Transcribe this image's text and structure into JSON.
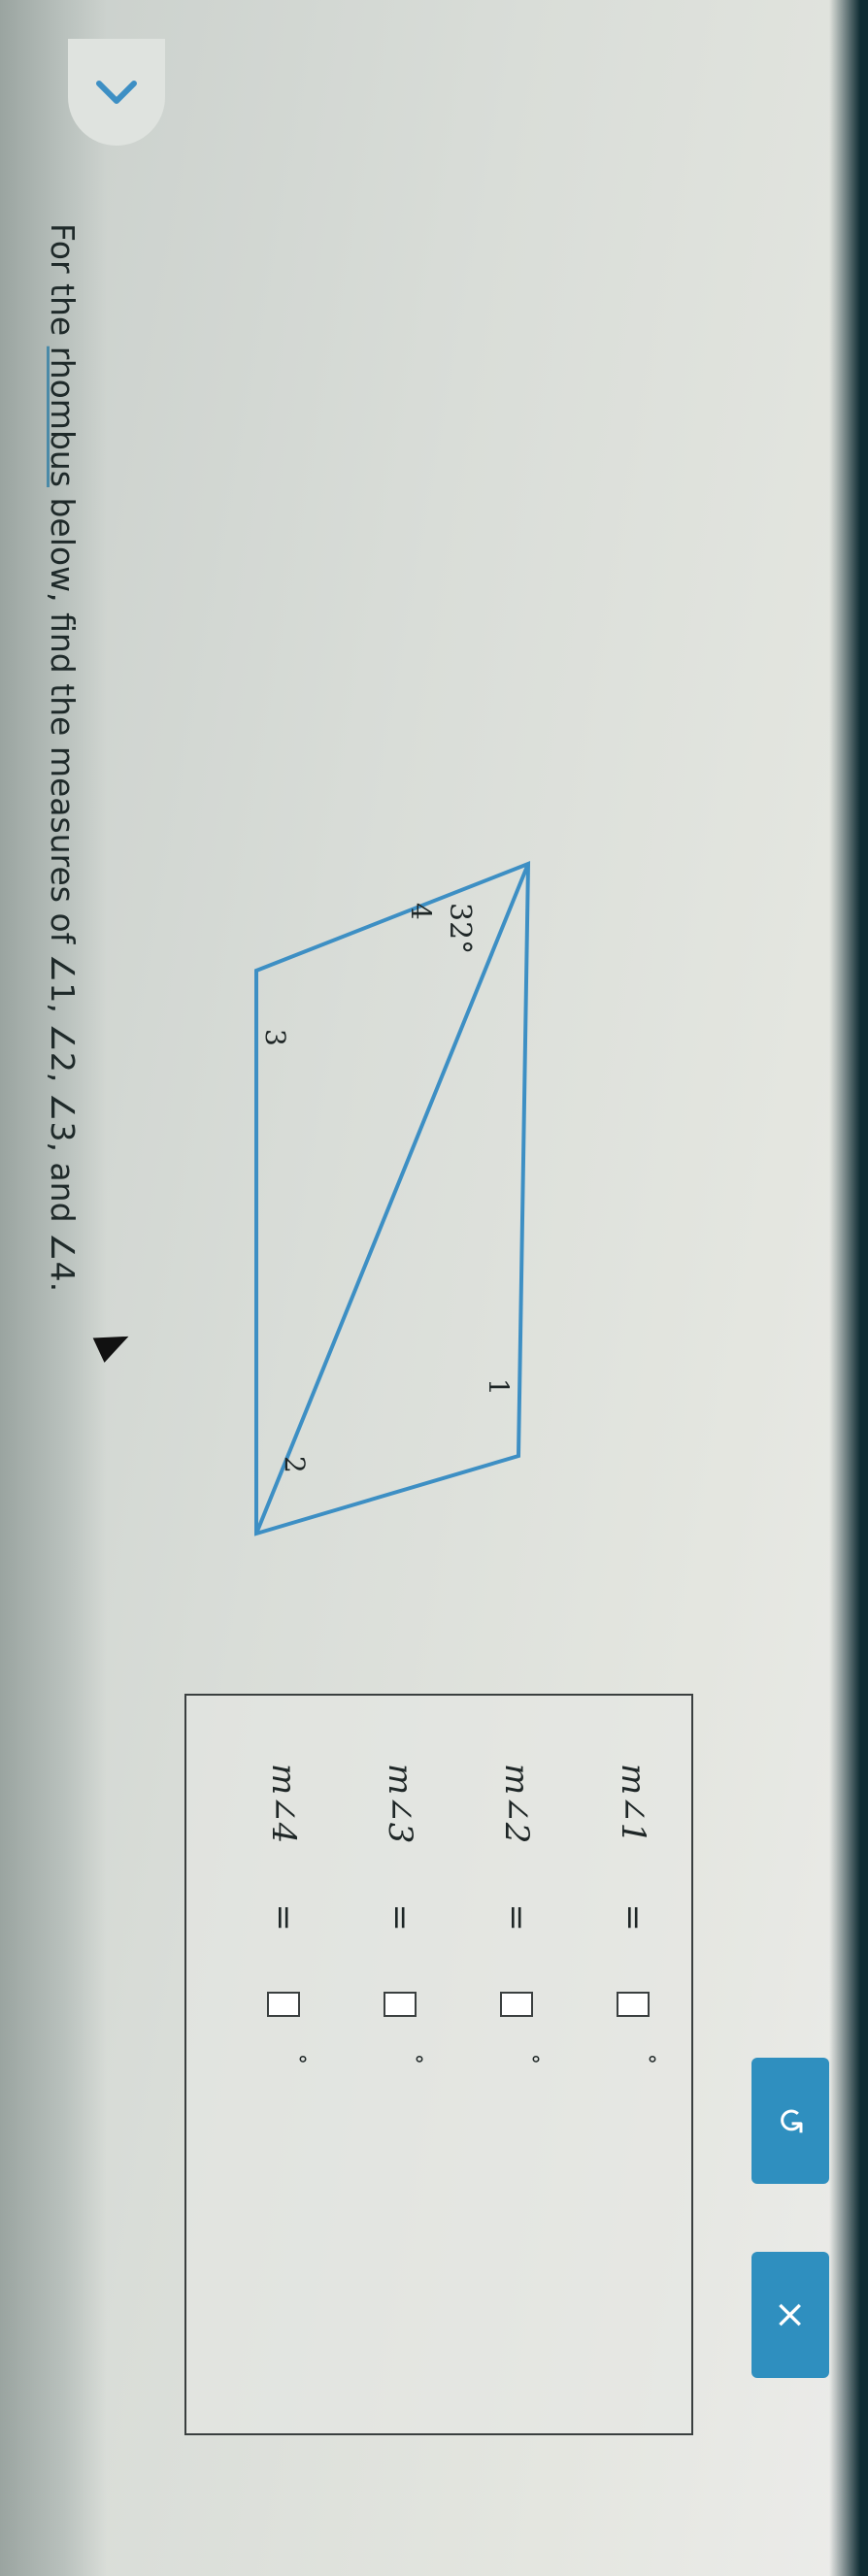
{
  "nav": {
    "back_icon": "chevron-down-icon"
  },
  "question": {
    "prefix": "For the ",
    "link": "rhombus",
    "suffix": " below, find the measures of ∠1, ∠2, ∠3, and ∠4."
  },
  "figure": {
    "shape": "rhombus",
    "given_angle": "32°",
    "labels": {
      "a1": "1",
      "a2": "2",
      "a3": "3",
      "a4": "4"
    },
    "stroke_color": "#3d8fc4"
  },
  "answers": [
    {
      "angle": "m∠1",
      "eq": "=",
      "value": "",
      "unit": "°"
    },
    {
      "angle": "m∠2",
      "eq": "=",
      "value": "",
      "unit": "°"
    },
    {
      "angle": "m∠3",
      "eq": "=",
      "value": "",
      "unit": "°"
    },
    {
      "angle": "m∠4",
      "eq": "=",
      "value": "",
      "unit": "°"
    }
  ],
  "buttons": {
    "undo_icon": "undo-icon",
    "clear_icon": "close-icon",
    "clear_label": "×",
    "undo_label": "↺"
  },
  "colors": {
    "accent": "#2f8fbf"
  }
}
